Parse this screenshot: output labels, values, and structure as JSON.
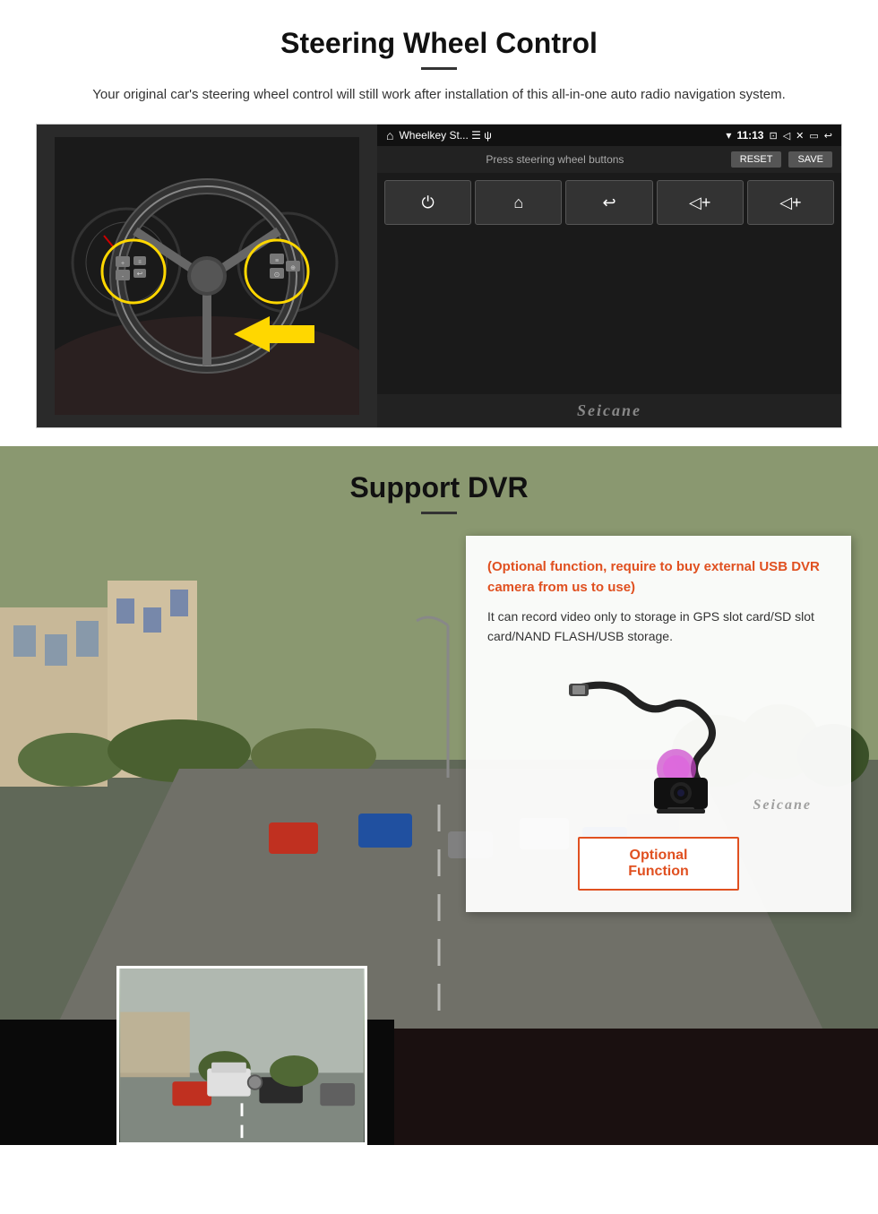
{
  "steering": {
    "title": "Steering Wheel Control",
    "subtitle": "Your original car's steering wheel control will still work after installation of this all-in-one auto radio navigation system.",
    "statusbar": {
      "home_icon": "⌂",
      "app_name": "Wheelkey St...  ☰ ψ",
      "wifi_icon": "▼",
      "time": "11:13",
      "cam_icon": "▣",
      "vol_icon": "◁",
      "close_icon": "✕",
      "back_icon": "⏎",
      "arrow_icon": "↩"
    },
    "press_label": "Press steering wheel buttons",
    "reset_label": "RESET",
    "save_label": "SAVE",
    "buttons": [
      {
        "icon": "⏻"
      },
      {
        "icon": "⌂"
      },
      {
        "icon": "↩"
      },
      {
        "icon": "◁+"
      },
      {
        "icon": "◁+"
      }
    ],
    "seicane": "Seicane"
  },
  "dvr": {
    "title": "Support DVR",
    "optional_text": "(Optional function, require to buy external USB DVR camera from us to use)",
    "desc_text": "It can record video only to storage in GPS slot card/SD slot card/NAND FLASH/USB storage.",
    "seicane": "Seicane",
    "optional_function_label": "Optional Function"
  }
}
